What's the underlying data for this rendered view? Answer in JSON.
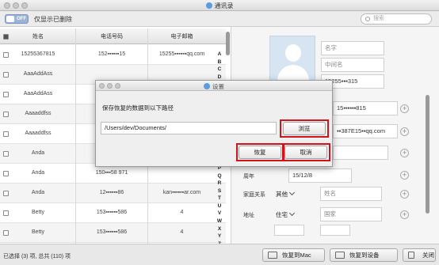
{
  "window": {
    "title": "通讯录"
  },
  "toolbar": {
    "toggle_label": "OFF",
    "show_deleted_label": "仅显示已删除",
    "search_placeholder": "搜索"
  },
  "table": {
    "headers": [
      "姓名",
      "电话号码",
      "电子邮箱"
    ],
    "rows": [
      {
        "name": "15255367815",
        "phone": "152▪▪▪▪▪▪15",
        "email": "15255▪▪▪▪▪▪qq.com"
      },
      {
        "name": "AaaAddAss",
        "phone": "",
        "email": ""
      },
      {
        "name": "AaaAddAss",
        "phone": "",
        "email": ""
      },
      {
        "name": "Aaaaddfss",
        "phone": "",
        "email": ""
      },
      {
        "name": "Aaaaddfss",
        "phone": "",
        "email": ""
      },
      {
        "name": "Anda",
        "phone": "",
        "email": ""
      },
      {
        "name": "Anda",
        "phone": "150▪▪▪58 971",
        "email": ""
      },
      {
        "name": "Anda",
        "phone": "12▪▪▪▪▪▪86",
        "email": "kan▪▪▪▪▪▪ar.com"
      },
      {
        "name": "Betty",
        "phone": "153▪▪▪▪▪▪586",
        "email": "4"
      },
      {
        "name": "Betty",
        "phone": "153▪▪▪▪▪▪586",
        "email": "4"
      }
    ]
  },
  "alphabet": [
    "A",
    "B",
    "C",
    "D",
    "E",
    "F",
    "G",
    "H",
    "I",
    "J",
    "K",
    "L",
    "M",
    "N",
    "O",
    "P",
    "Q",
    "R",
    "S",
    "T",
    "U",
    "V",
    "W",
    "X",
    "Y",
    "Z",
    "#"
  ],
  "detail": {
    "first_name_placeholder": "名字",
    "middle_name_placeholder": "中间名",
    "title_value": "15255▪▪▪315",
    "phone_value": "15▪▪▪▪▪▪815",
    "email_value": "▪▪387E15▪▪qq.com",
    "anniversary_label": "周年",
    "anniversary_value": "15/12/8",
    "relation_label": "家庭关系",
    "relation_select": "其他",
    "relation_name_placeholder": "姓名",
    "address_label": "地址",
    "address_select": "住宅",
    "country_placeholder": "国家"
  },
  "footer": {
    "status": "已选择 (3) 项, 总共 (110) 项",
    "restore_mac": "恢复到Mac",
    "restore_device": "恢复到设备",
    "close": "关闭"
  },
  "dialog": {
    "title": "设置",
    "message": "保存恢复的数据到以下路径",
    "path": "/Users/dev/Documents/",
    "browse": "浏览",
    "restore": "恢复",
    "cancel": "取消",
    "highlight_color": "#d0141b"
  }
}
